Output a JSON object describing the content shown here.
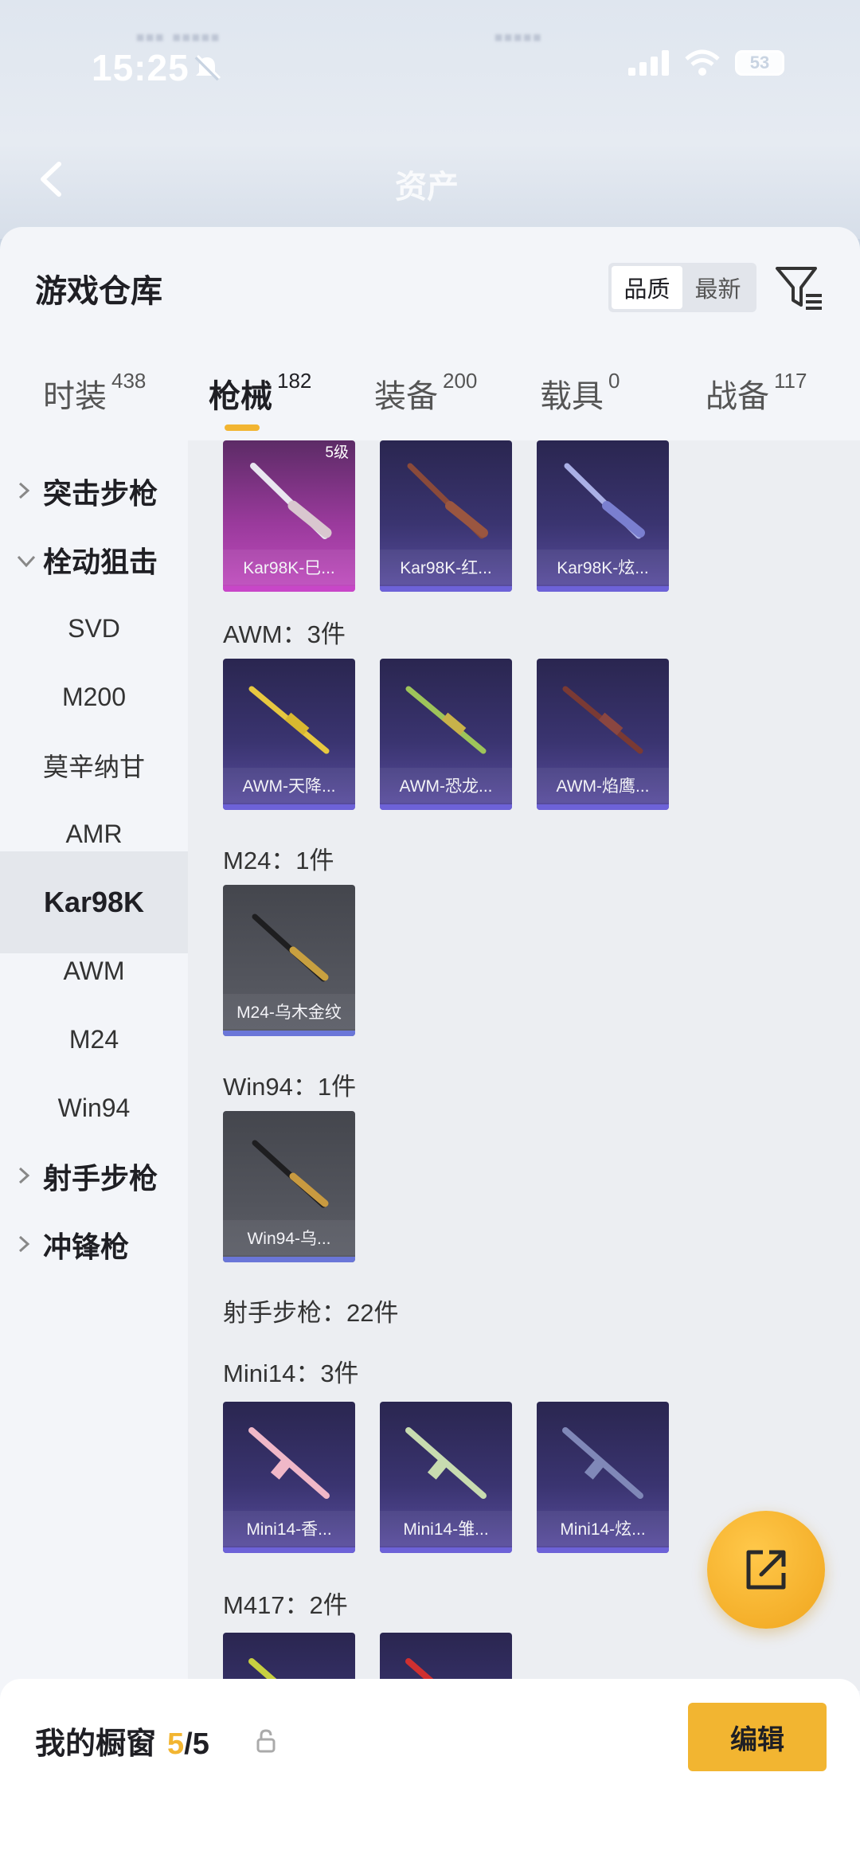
{
  "status_bar": {
    "time": "15:25",
    "battery": "53"
  },
  "header": {
    "title": "资产"
  },
  "sheet": {
    "title": "游戏仓库",
    "sort_options": [
      "品质",
      "最新"
    ],
    "active_sort": "品质"
  },
  "tabs": [
    {
      "label": "时装",
      "count": "438"
    },
    {
      "label": "枪械",
      "count": "182"
    },
    {
      "label": "装备",
      "count": "200"
    },
    {
      "label": "载具",
      "count": "0"
    },
    {
      "label": "战备",
      "count": "117"
    }
  ],
  "sidebar": {
    "items": [
      {
        "label": "突击步枪"
      },
      {
        "label": "栓动狙击"
      },
      {
        "label": "SVD"
      },
      {
        "label": "M200"
      },
      {
        "label": "莫辛纳甘"
      },
      {
        "label": "AMR"
      },
      {
        "label": "Kar98K"
      },
      {
        "label": "AWM"
      },
      {
        "label": "M24"
      },
      {
        "label": "Win94"
      },
      {
        "label": "射手步枪"
      },
      {
        "label": "冲锋枪"
      }
    ]
  },
  "content": {
    "sections": [
      {
        "label": "AWM：3件"
      },
      {
        "label": "M24：1件"
      },
      {
        "label": "Win94：1件"
      },
      {
        "label": "射手步枪：22件"
      },
      {
        "label": "Mini14：3件"
      },
      {
        "label": "M417：2件"
      }
    ],
    "cards": [
      {
        "name": "Kar98K-巳...",
        "level": "5级"
      },
      {
        "name": "Kar98K-红..."
      },
      {
        "name": "Kar98K-炫..."
      },
      {
        "name": "AWM-天降..."
      },
      {
        "name": "AWM-恐龙..."
      },
      {
        "name": "AWM-焰鹰..."
      },
      {
        "name": "M24-乌木金纹"
      },
      {
        "name": "Win94-乌..."
      },
      {
        "name": "Mini14-香..."
      },
      {
        "name": "Mini14-雏..."
      },
      {
        "name": "Mini14-炫..."
      }
    ]
  },
  "showcase": {
    "label": "我的橱窗",
    "current": "5",
    "max": "/5",
    "edit_label": "编辑"
  },
  "colors": {
    "accent": "#f2b531",
    "purple_card": "#3a3470",
    "pink_card": "#9a3a9c"
  }
}
